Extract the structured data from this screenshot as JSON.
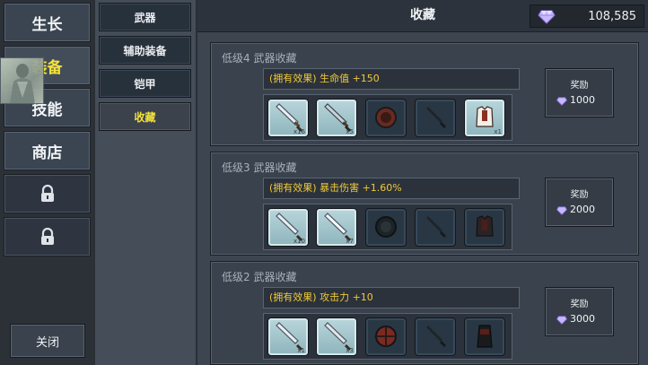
{
  "nav": {
    "items": [
      {
        "label": "生长",
        "active": false
      },
      {
        "label": "装备",
        "active": true
      },
      {
        "label": "技能",
        "active": false
      },
      {
        "label": "商店",
        "active": false
      }
    ],
    "locked_count": 2,
    "close_label": "关闭"
  },
  "categories": {
    "items": [
      {
        "label": "武器",
        "active": false
      },
      {
        "label": "辅助装备",
        "active": false
      },
      {
        "label": "铠甲",
        "active": false
      },
      {
        "label": "收藏",
        "active": true
      }
    ]
  },
  "header": {
    "title": "收藏",
    "gems": "108,585"
  },
  "collections": [
    {
      "title": "低级4 武器收藏",
      "effect": "(拥有效果) 生命值 +150",
      "reward_label": "奖励",
      "reward_amount": "1000",
      "slots": [
        {
          "item": "sword-icon",
          "owned": true,
          "count": "x16"
        },
        {
          "item": "sword-icon",
          "owned": true,
          "count": "x5"
        },
        {
          "item": "shield-icon",
          "owned": false,
          "count": ""
        },
        {
          "item": "dagger-icon",
          "owned": false,
          "count": ""
        },
        {
          "item": "armor-icon",
          "owned": true,
          "count": "x1"
        }
      ]
    },
    {
      "title": "低级3 武器收藏",
      "effect": "(拥有效果) 暴击伤害 +1.60%",
      "reward_label": "奖励",
      "reward_amount": "2000",
      "slots": [
        {
          "item": "sword-icon",
          "owned": true,
          "count": "x10"
        },
        {
          "item": "sword-icon",
          "owned": true,
          "count": "x7"
        },
        {
          "item": "shield-icon",
          "owned": false,
          "count": ""
        },
        {
          "item": "dagger-icon",
          "owned": false,
          "count": ""
        },
        {
          "item": "armor-icon",
          "owned": false,
          "count": ""
        }
      ]
    },
    {
      "title": "低级2 武器收藏",
      "effect": "(拥有效果) 攻击力 +10",
      "reward_label": "奖励",
      "reward_amount": "3000",
      "slots": [
        {
          "item": "sword-icon",
          "owned": true,
          "count": "x1"
        },
        {
          "item": "sword-icon",
          "owned": true,
          "count": "x3"
        },
        {
          "item": "shield-icon",
          "owned": false,
          "count": ""
        },
        {
          "item": "dagger-icon",
          "owned": false,
          "count": ""
        },
        {
          "item": "armor-icon",
          "owned": false,
          "count": ""
        }
      ]
    }
  ],
  "colors": {
    "active_text": "#f3e23c",
    "effect_text": "#f0c93a",
    "gem": "#c9b8ff"
  }
}
